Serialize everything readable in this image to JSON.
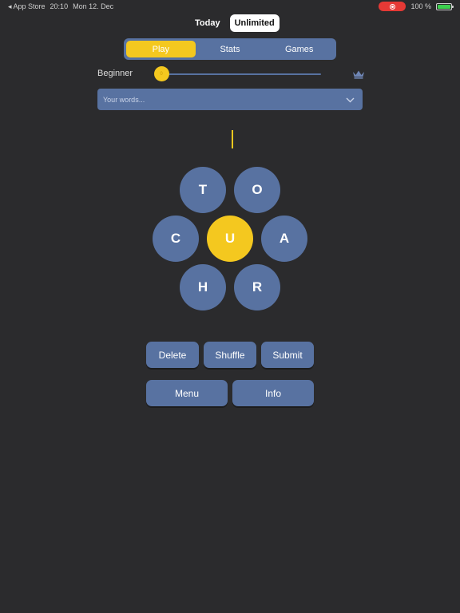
{
  "status_bar": {
    "back_label": "◂ App Store",
    "time": "20:10",
    "date": "Mon 12. Dec",
    "battery": "100 %"
  },
  "mode_toggle": {
    "today_label": "Today",
    "unlimited_label": "Unlimited",
    "selected": "Unlimited"
  },
  "nav": {
    "tabs": [
      {
        "label": "Play",
        "active": true
      },
      {
        "label": "Stats",
        "active": false
      },
      {
        "label": "Games",
        "active": false
      }
    ]
  },
  "difficulty": {
    "label": "Beginner",
    "thumb_value": "0",
    "level_fraction": 0.0
  },
  "words_dropdown": {
    "placeholder": "Your words..."
  },
  "letters": {
    "center": "U",
    "outer": [
      "T",
      "O",
      "C",
      "A",
      "H",
      "R"
    ]
  },
  "actions": {
    "delete_label": "Delete",
    "shuffle_label": "Shuffle",
    "submit_label": "Submit",
    "menu_label": "Menu",
    "info_label": "Info"
  },
  "colors": {
    "background": "#2b2b2d",
    "panel": "#5872a1",
    "accent": "#f4c81f",
    "record": "#e53935",
    "battery": "#3ccf4e"
  }
}
